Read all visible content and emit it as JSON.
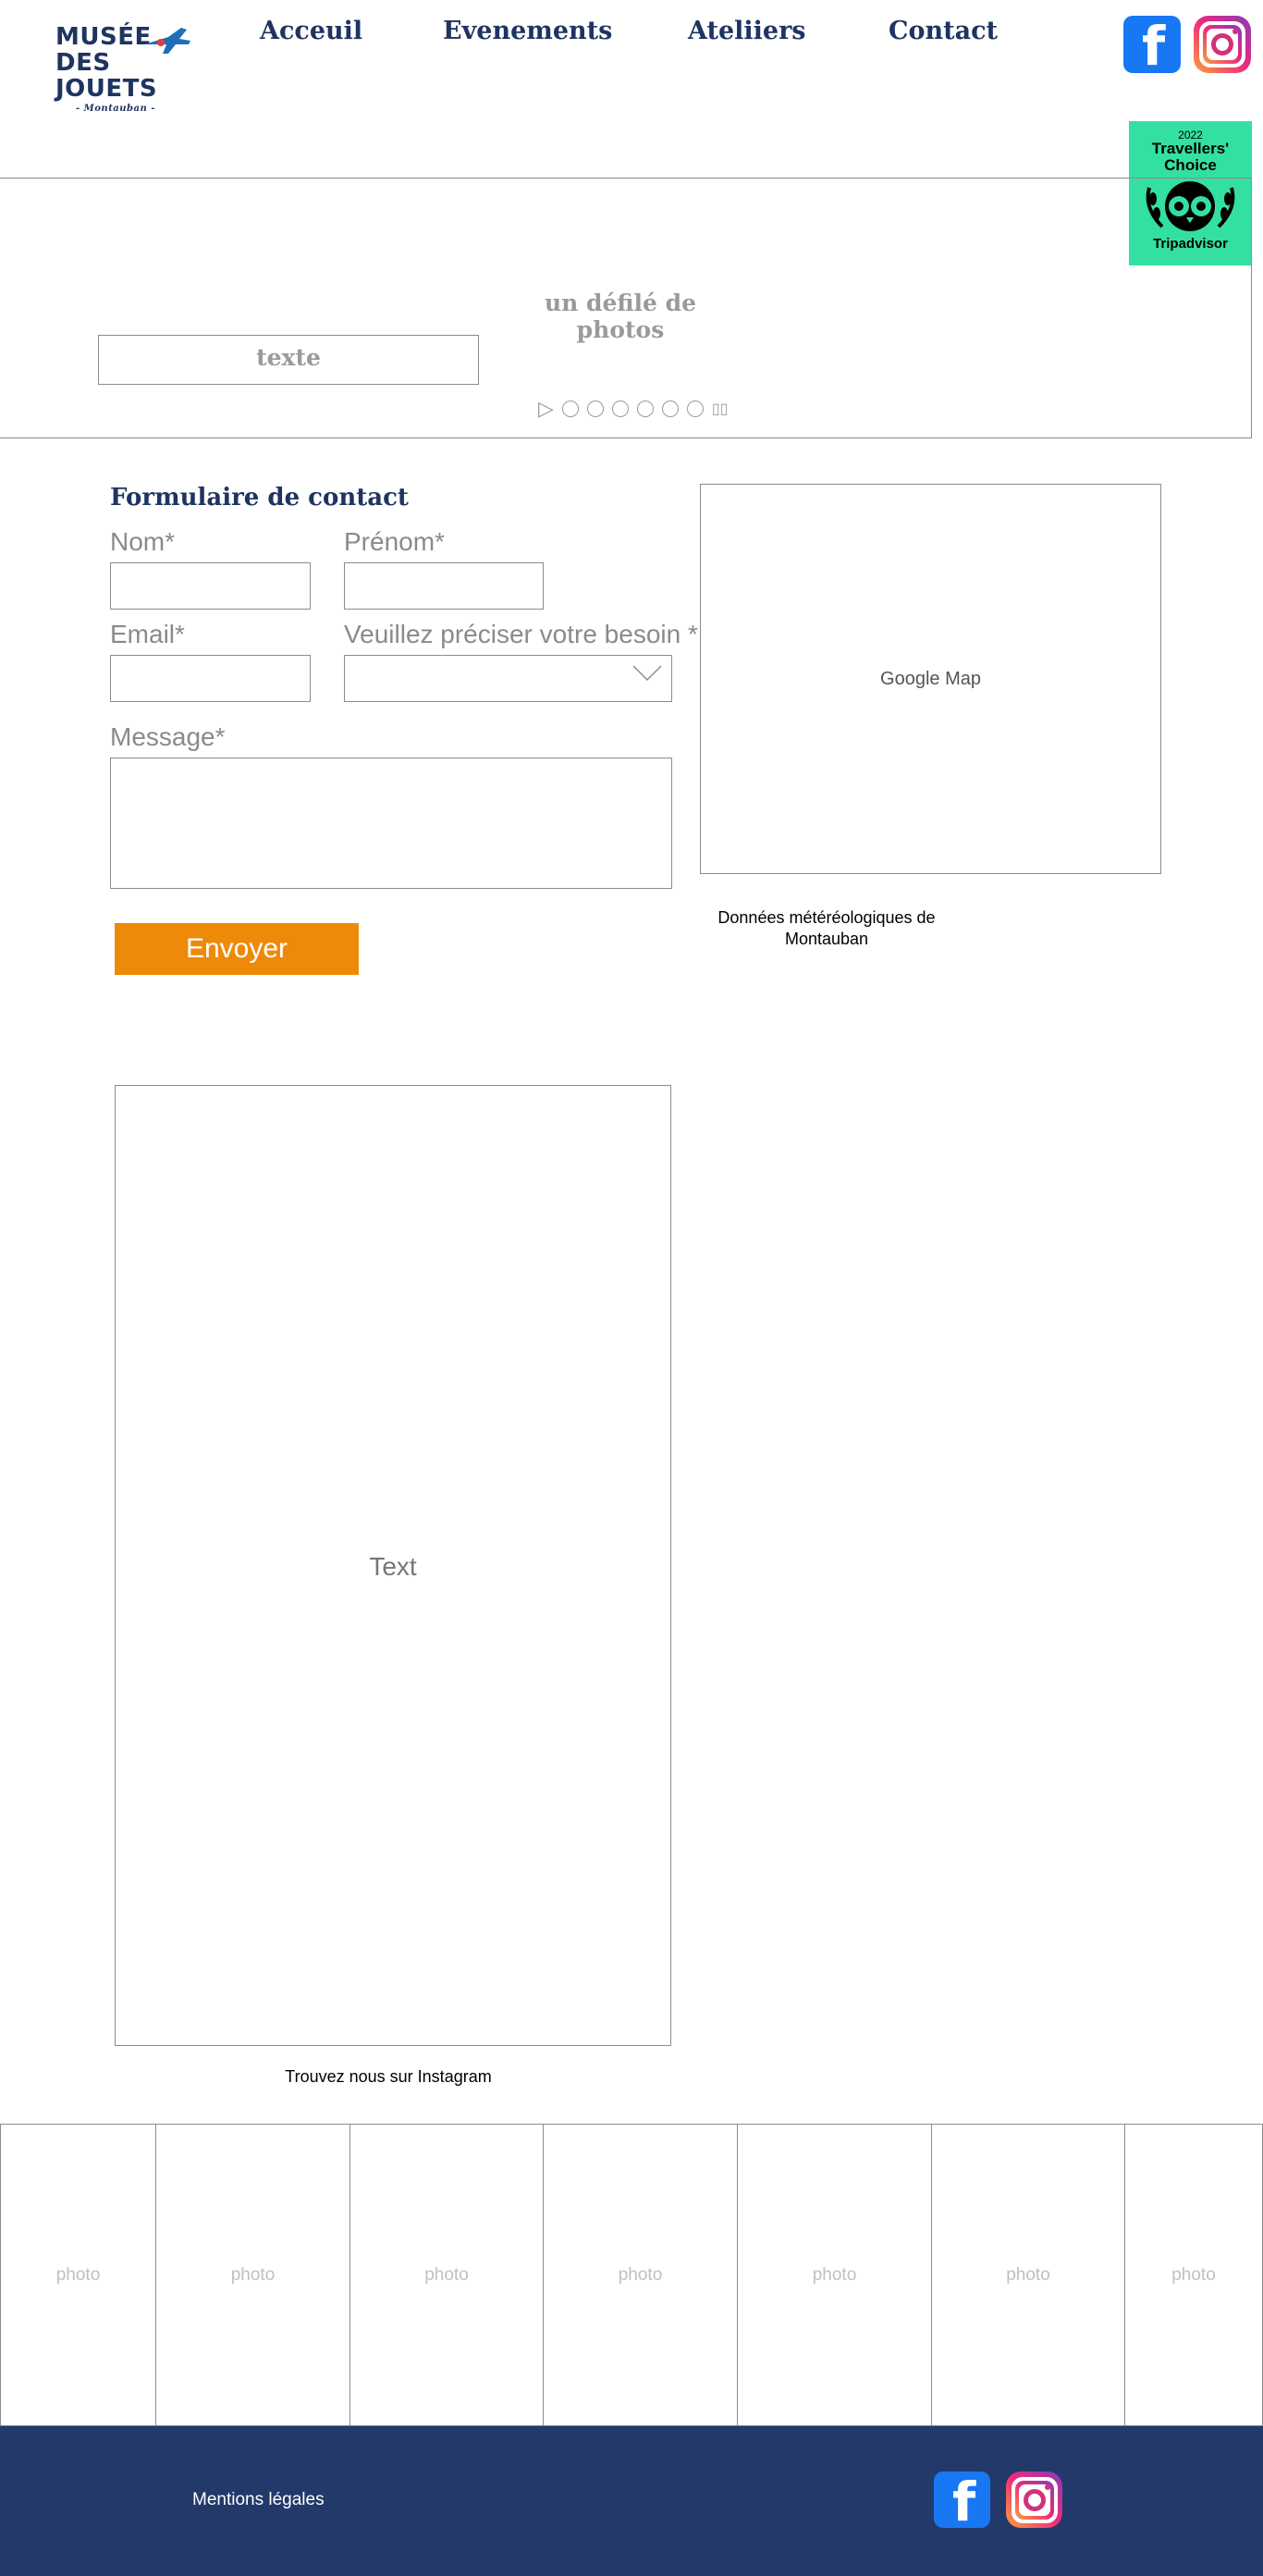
{
  "header": {
    "logo": {
      "line1": "MUSÉE",
      "line2": "DES JOUETS",
      "line3": "- Montauban -"
    },
    "nav": [
      {
        "label": "Acceuil"
      },
      {
        "label": "Evenements"
      },
      {
        "label": "Ateliiers"
      },
      {
        "label": "Contact"
      }
    ],
    "social": {
      "facebook": "facebook-icon",
      "instagram": "instagram-icon"
    }
  },
  "badge": {
    "year": "2022",
    "line1": "Travellers'",
    "line2": "Choice",
    "brand": "Tripadvisor",
    "color": "#34e0a1"
  },
  "slideshow": {
    "title": "un défilé de photos",
    "text": "texte",
    "play_icon": "▷",
    "dot_count": 6,
    "expand_icon": "▯▯"
  },
  "contact_form": {
    "title": "Formulaire de contact",
    "fields": {
      "nom": {
        "label": "Nom*",
        "value": ""
      },
      "prenom": {
        "label": "Prénom*",
        "value": ""
      },
      "email": {
        "label": "Email*",
        "value": ""
      },
      "besoin": {
        "label": "Veuillez préciser votre besoin *",
        "value": ""
      },
      "message": {
        "label": "Message*",
        "value": ""
      }
    },
    "submit_label": "Envoyer",
    "submit_color": "#ee8a0a"
  },
  "map": {
    "label": "Google Map"
  },
  "meteo": {
    "line1": "Données météréologiques de",
    "line2": "Montauban"
  },
  "text_block": {
    "label": "Text"
  },
  "instagram": {
    "caption": "Trouvez nous sur Instagram"
  },
  "photos": [
    {
      "label": "photo"
    },
    {
      "label": "photo"
    },
    {
      "label": "photo"
    },
    {
      "label": "photo"
    },
    {
      "label": "photo"
    },
    {
      "label": "photo"
    },
    {
      "label": "photo"
    }
  ],
  "footer": {
    "legal_label": "Mentions légales",
    "background": "#22396a",
    "social": {
      "facebook": "facebook-icon",
      "instagram": "instagram-icon"
    }
  },
  "colors": {
    "brand_navy": "#1e3461",
    "accent_orange": "#ee8a0a"
  }
}
